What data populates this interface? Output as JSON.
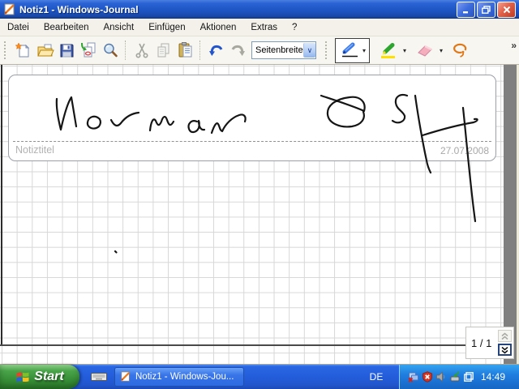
{
  "window": {
    "title": "Notiz1 - Windows-Journal"
  },
  "menu": {
    "items": [
      "Datei",
      "Bearbeiten",
      "Ansicht",
      "Einfügen",
      "Aktionen",
      "Extras",
      "?"
    ]
  },
  "toolbar": {
    "zoom_value": "Seitenbreite",
    "dropdown_arrow": "▾",
    "combo_arrow": "∨",
    "overflow": "»",
    "icons": [
      "new-note",
      "open",
      "save",
      "import",
      "page-view",
      "cut",
      "copy",
      "paste",
      "undo",
      "redo",
      "pen",
      "highlighter",
      "eraser",
      "lasso"
    ]
  },
  "note": {
    "title_placeholder": "Notiztitel",
    "date": "27.07.2008",
    "handwriting": "Norman OSH",
    "ink": {
      "strokes": [
        "M70,42 C69,54 72,68 75,80 C79,62 84,46 88,40 C90,52 92,64 94,76",
        "M123,67 C117,61 109,64 108,71 C107,78 116,81 122,76 C125,72 124,69 123,67",
        "M137,68 C140,74 144,78 149,72 C155,64 162,60 171,59",
        "M185,81 C186,71 189,64 192,69 C194,74 196,77 199,70 C201,63 204,62 206,68 C208,74 210,77 214,70",
        "M243,70 C236,67 231,73 233,79 C235,85 242,84 245,78 C246,74 246,71 245,69 C245,75 247,81 252,80",
        "M261,84 C264,75 267,70 269,73 C271,76 271,81 274,82 C278,73 286,65 295,62 C301,60 304,64 302,70",
        "M396,38 C414,44 436,51 449,57 C452,46 444,38 431,40 C414,42 403,50 404,61 C405,72 419,78 434,76 C446,74 451,66 448,58",
        "M502,38 C494,35 487,39 488,47 C489,55 497,57 499,63 C500,70 491,74 484,69",
        "M512,38 C515,60 521,95 526,118 C527,124 529,129 531,133",
        "M521,87 C540,81 566,74 584,71 C590,69 590,66 585,67",
        "M571,53 C575,90 580,150 586,193",
        "M142,230 L143.5,231.5"
      ]
    }
  },
  "pager": {
    "current": "1 / 1"
  },
  "taskbar": {
    "start": "Start",
    "task": "Notiz1 - Windows-Jou...",
    "language": "DE",
    "clock": "14:49"
  },
  "colors": {
    "titlebar_blue": "#1e55c4",
    "taskbar_blue": "#245edc",
    "start_green": "#389038",
    "tray_blue": "#1f7ee0",
    "ink_black": "#151515",
    "grid_gray": "#d7d7d7",
    "outside_gray": "#808080",
    "focus_navy": "#26457e"
  }
}
